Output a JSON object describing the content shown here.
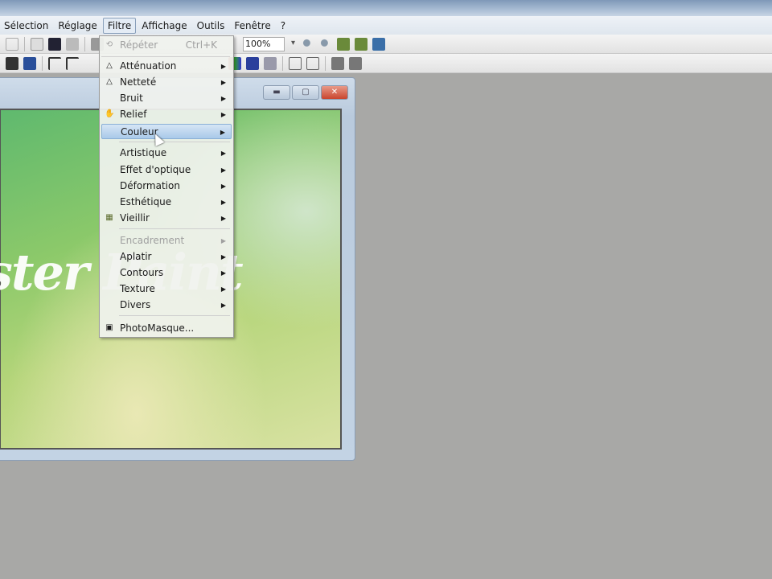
{
  "menubar": {
    "items": [
      "Sélection",
      "Réglage",
      "Filtre",
      "Affichage",
      "Outils",
      "Fenêtre",
      "?"
    ],
    "active": "Filtre"
  },
  "toolbar": {
    "zoom": "100%"
  },
  "filter_menu": {
    "repeat": {
      "label": "Répéter",
      "shortcut": "Ctrl+K"
    },
    "items": [
      {
        "label": "Atténuation",
        "icon": "drop-icon",
        "submenu": true
      },
      {
        "label": "Netteté",
        "icon": "drop-icon",
        "submenu": true
      },
      {
        "label": "Bruit",
        "submenu": true
      },
      {
        "label": "Relief",
        "icon": "relief-icon",
        "submenu": true
      },
      {
        "label": "Couleur",
        "submenu": true,
        "highlighted": true
      },
      {
        "label": "Artistique",
        "submenu": true
      },
      {
        "label": "Effet d'optique",
        "submenu": true
      },
      {
        "label": "Déformation",
        "submenu": true
      },
      {
        "label": "Esthétique",
        "submenu": true
      },
      {
        "label": "Vieillir",
        "icon": "vieillir-icon",
        "submenu": true
      },
      {
        "label": "Encadrement",
        "submenu": true,
        "disabled": true
      },
      {
        "label": "Aplatir",
        "submenu": true
      },
      {
        "label": "Contours",
        "submenu": true
      },
      {
        "label": "Texture",
        "submenu": true
      },
      {
        "label": "Divers",
        "submenu": true
      },
      {
        "label": "PhotoMasque...",
        "icon": "photomasque-icon"
      }
    ]
  },
  "document": {
    "image_text": "ster Paint"
  }
}
